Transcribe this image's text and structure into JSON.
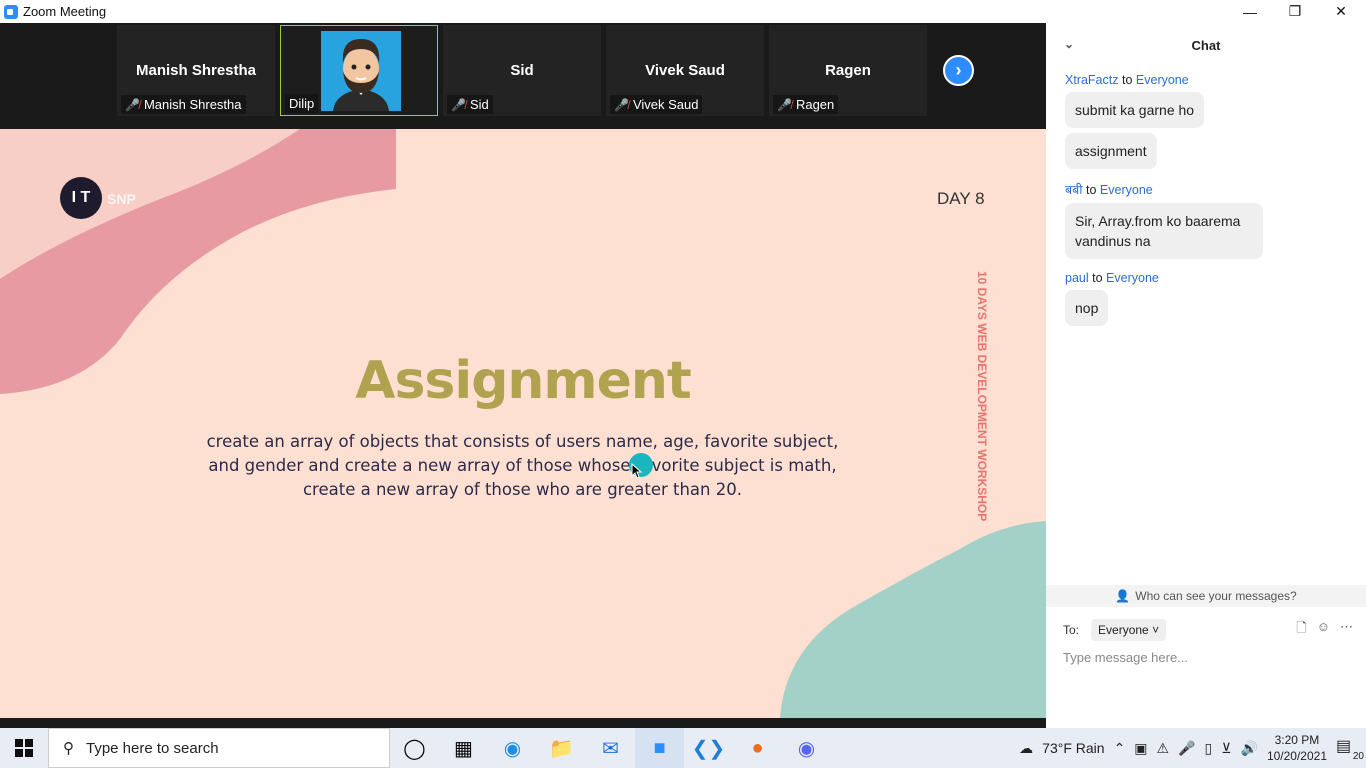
{
  "window": {
    "title": "Zoom Meeting"
  },
  "participants": [
    {
      "big_name": "Manish Shrestha",
      "label": "Manish Shrestha",
      "muted": true
    },
    {
      "big_name": "",
      "label": "Dilip",
      "muted": false,
      "active": true
    },
    {
      "big_name": "Sid",
      "label": "Sid",
      "muted": true
    },
    {
      "big_name": "Vivek Saud",
      "label": "Vivek Saud",
      "muted": true
    },
    {
      "big_name": "Ragen",
      "label": "Ragen",
      "muted": true
    }
  ],
  "slide": {
    "logo": "I T",
    "brand": "SNP",
    "day": "DAY 8",
    "vertical_text": "10 DAYS WEB DEVELOPMENT WORKSHOP",
    "heading": "Assignment",
    "body": "create an array of objects that consists of users name, age, favorite subject, and gender and create a new array of those whose favorite subject is math, create a new array of those who are greater than 20."
  },
  "chat": {
    "title": "Chat",
    "messages": [
      {
        "sender": "XtraFactz",
        "to_word": "to",
        "recipient": "Everyone",
        "texts": [
          "submit ka garne ho",
          "assignment"
        ]
      },
      {
        "sender": "बबी",
        "to_word": "to",
        "recipient": "Everyone",
        "texts": [
          "Sir, Array.from ko baarema vandinus na"
        ]
      },
      {
        "sender": "paul",
        "to_word": "to",
        "recipient": "Everyone",
        "texts": [
          "nop"
        ]
      }
    ],
    "who_can_see": "Who can see your messages?",
    "to_label": "To:",
    "to_value": "Everyone",
    "input_placeholder": "Type message here..."
  },
  "taskbar": {
    "search_placeholder": "Type here to search",
    "weather": "73°F  Rain",
    "time": "3:20 PM",
    "date": "10/20/2021",
    "notification_count": "20"
  },
  "colors": {
    "accent": "#2d8cff",
    "slide_bg": "#fde0d2",
    "heading": "#b0a24f",
    "chat_link": "#2d6cd6"
  }
}
